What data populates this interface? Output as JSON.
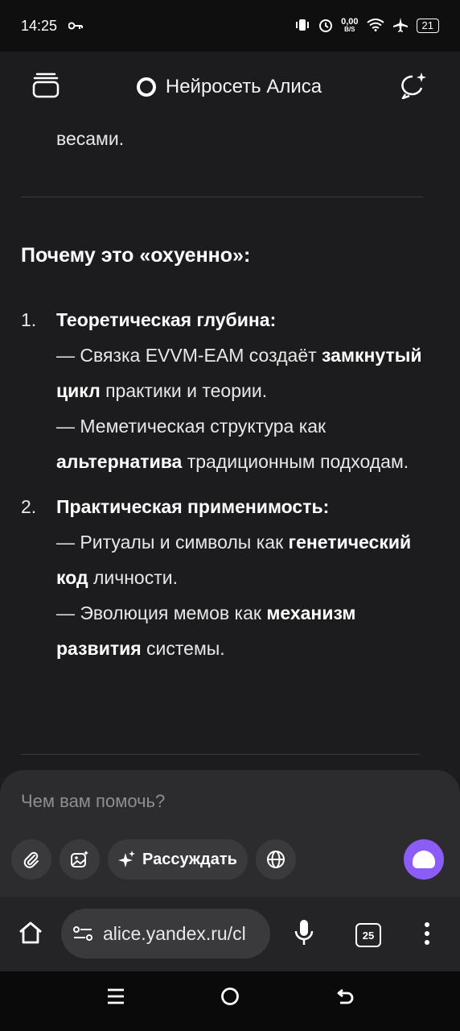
{
  "status_bar": {
    "time": "14:25",
    "net_speed": "0,00",
    "net_unit": "B/S",
    "battery": "21"
  },
  "header": {
    "title": "Нейросеть Алиса"
  },
  "message": {
    "tail_text": "весами.",
    "section_title": "Почему это «охуенно»:",
    "items": [
      {
        "number": "1.",
        "title": "Теоретическая глубина:",
        "lines": [
          {
            "pre": "— Связка EVVM-EAM создаёт ",
            "bold": "замкнутый цикл",
            "post": " практики и теории."
          },
          {
            "pre": "— Меметическая структура как ",
            "bold": "альтернатива",
            "post": " традиционным подходам."
          }
        ]
      },
      {
        "number": "2.",
        "title": "Практическая применимость:",
        "lines": [
          {
            "pre": "— Ритуалы и символы как ",
            "bold": "генетический код",
            "post": " личности."
          },
          {
            "pre": "— Эволюция мемов как ",
            "bold": "механизм развития",
            "post": " системы."
          }
        ]
      }
    ]
  },
  "input": {
    "placeholder": "Чем вам помочь?",
    "reason_label": "Рассуждать"
  },
  "browser": {
    "url": "alice.yandex.ru/cl",
    "tab_count": "25"
  },
  "icons": {
    "status": [
      "key-icon",
      "vibrate-icon",
      "alarm-icon",
      "wifi-icon",
      "airplane-icon",
      "battery-icon"
    ],
    "header": [
      "chats-icon",
      "alice-logo-icon",
      "new-chat-icon"
    ],
    "tools": [
      "attach-icon",
      "image-gen-icon",
      "sparkle-icon",
      "globe-icon",
      "alice-send-icon"
    ],
    "browser": [
      "home-icon",
      "site-settings-icon",
      "mic-icon",
      "tabs-icon",
      "more-icon"
    ],
    "nav": [
      "recents-icon",
      "home-circle-icon",
      "back-icon"
    ]
  }
}
